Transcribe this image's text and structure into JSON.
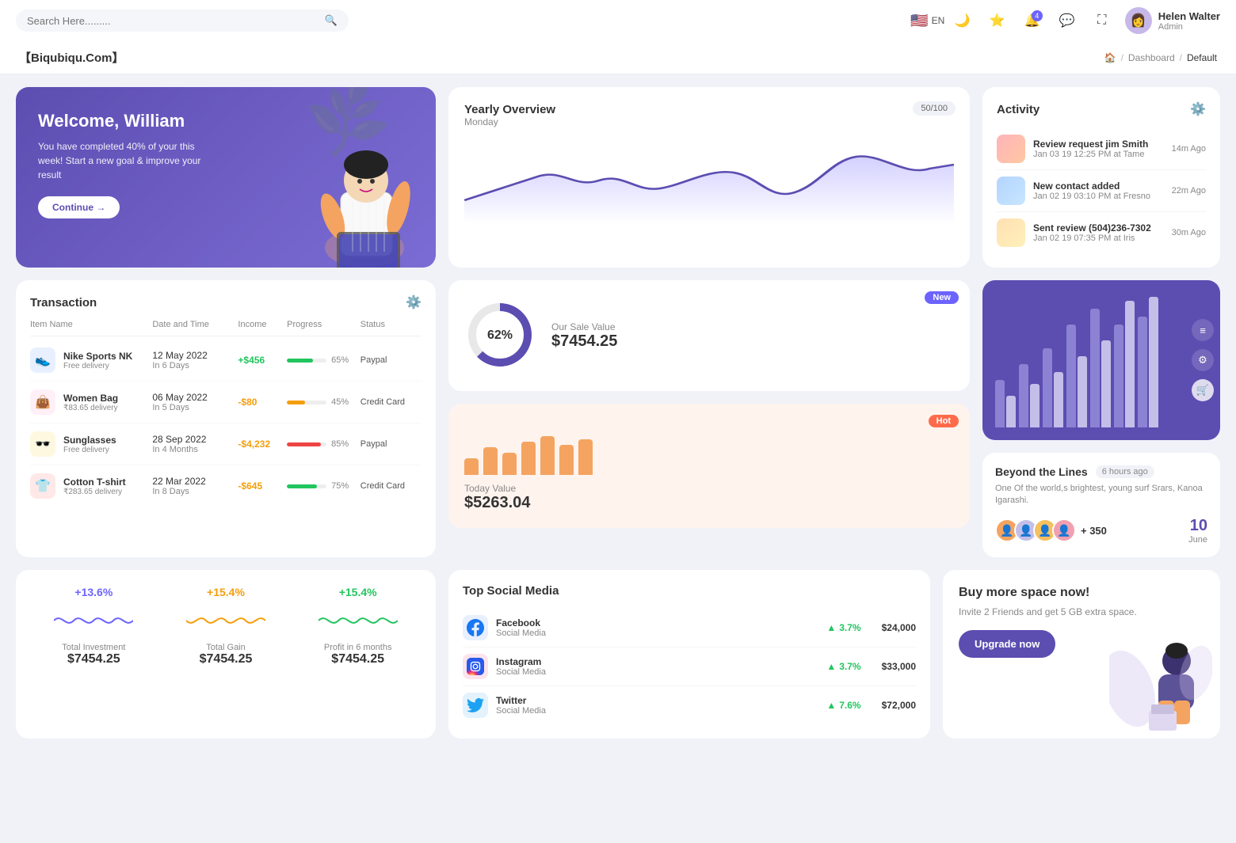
{
  "nav": {
    "search_placeholder": "Search Here.........",
    "lang": "EN",
    "notification_count": "4",
    "user": {
      "name": "Helen Walter",
      "role": "Admin"
    }
  },
  "breadcrumb": {
    "brand": "【Biqubiqu.Com】",
    "home": "🏠",
    "dashboard": "Dashboard",
    "current": "Default"
  },
  "welcome": {
    "title": "Welcome, William",
    "desc": "You have completed 40% of your this week! Start a new goal & improve your result",
    "btn": "Continue →"
  },
  "yearly": {
    "title": "Yearly Overview",
    "day": "Monday",
    "badge": "50/100"
  },
  "activity": {
    "title": "Activity",
    "items": [
      {
        "title": "Review request jim Smith",
        "sub": "Jan 03 19 12:25 PM at Tame",
        "time": "14m Ago"
      },
      {
        "title": "New contact added",
        "sub": "Jan 02 19 03:10 PM at Fresno",
        "time": "22m Ago"
      },
      {
        "title": "Sent review (504)236-7302",
        "sub": "Jan 02 19 07:35 PM at Iris",
        "time": "30m Ago"
      }
    ]
  },
  "transaction": {
    "title": "Transaction",
    "headers": [
      "Item Name",
      "Date and Time",
      "Income",
      "Progress",
      "Status"
    ],
    "rows": [
      {
        "icon": "👟",
        "icon_bg": "#e8f0ff",
        "name": "Nike Sports NK",
        "sub": "Free delivery",
        "date": "12 May 2022",
        "days": "In 6 Days",
        "income": "+$456",
        "income_pos": true,
        "progress": 65,
        "progress_color": "#22c55e",
        "status": "Paypal"
      },
      {
        "icon": "👜",
        "icon_bg": "#fff0f8",
        "name": "Women Bag",
        "sub": "₹83.65 delivery",
        "date": "06 May 2022",
        "days": "In 5 Days",
        "income": "-$80",
        "income_pos": false,
        "progress": 45,
        "progress_color": "#f59e0b",
        "status": "Credit Card"
      },
      {
        "icon": "🕶️",
        "icon_bg": "#fff8e0",
        "name": "Sunglasses",
        "sub": "Free delivery",
        "date": "28 Sep 2022",
        "days": "In 4 Months",
        "income": "-$4,232",
        "income_pos": false,
        "progress": 85,
        "progress_color": "#ef4444",
        "status": "Paypal"
      },
      {
        "icon": "👕",
        "icon_bg": "#ffe8e8",
        "name": "Cotton T-shirt",
        "sub": "₹283.65 delivery",
        "date": "22 Mar 2022",
        "days": "In 8 Days",
        "income": "-$645",
        "income_pos": false,
        "progress": 75,
        "progress_color": "#22c55e",
        "status": "Credit Card"
      }
    ]
  },
  "sale": {
    "badge": "New",
    "pct": "62%",
    "label": "Our Sale Value",
    "value": "$7454.25"
  },
  "today": {
    "badge": "Hot",
    "label": "Today Value",
    "value": "$5263.04",
    "bars": [
      30,
      50,
      40,
      60,
      70,
      55,
      65
    ]
  },
  "beyond": {
    "title": "Beyond the Lines",
    "time": "6 hours ago",
    "desc": "One Of the world,s brightest, young surf Srars, Kanoa Igarashi.",
    "plus": "+ 350",
    "date_num": "10",
    "date_mon": "June"
  },
  "stats": [
    {
      "pct": "+13.6%",
      "pct_color": "#6c63ff",
      "label": "Total Investment",
      "value": "$7454.25",
      "wave_color": "#6c63ff"
    },
    {
      "pct": "+15.4%",
      "pct_color": "#f59e0b",
      "label": "Total Gain",
      "value": "$7454.25",
      "wave_color": "#f59e0b"
    },
    {
      "pct": "+15.4%",
      "pct_color": "#22c55e",
      "label": "Profit in 6 months",
      "value": "$7454.25",
      "wave_color": "#22c55e"
    }
  ],
  "social": {
    "title": "Top Social Media",
    "items": [
      {
        "name": "Facebook",
        "type": "Social Media",
        "growth": "3.7%",
        "amount": "$24,000",
        "icon": "🔵",
        "icon_bg": "#e8f0ff"
      },
      {
        "name": "Instagram",
        "type": "Social Media",
        "growth": "3.7%",
        "amount": "$33,000",
        "icon": "📷",
        "icon_bg": "#fce4ec"
      },
      {
        "name": "Twitter",
        "type": "Social Media",
        "growth": "7.6%",
        "amount": "$72,000",
        "icon": "🐦",
        "icon_bg": "#e3f2fd"
      }
    ]
  },
  "buy": {
    "title": "Buy more space now!",
    "desc": "Invite 2 Friends and get 5 GB extra space.",
    "btn": "Upgrade now"
  }
}
